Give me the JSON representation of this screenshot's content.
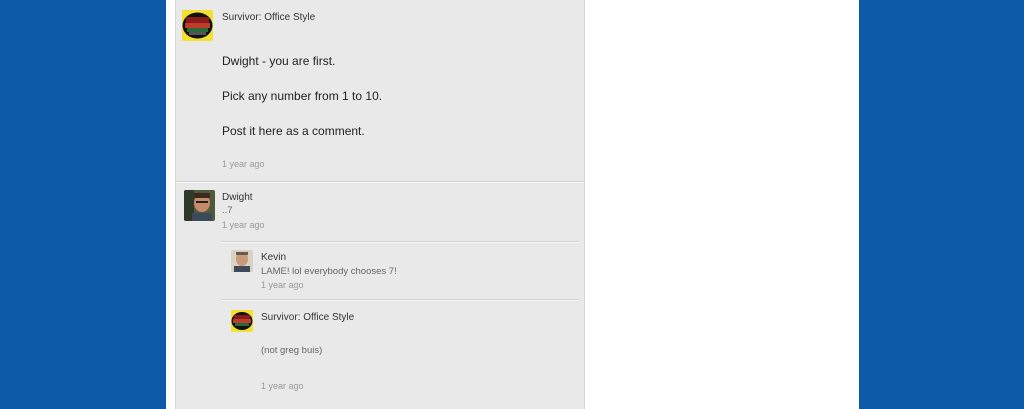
{
  "main_post": {
    "author": "Survivor: Office Style",
    "lines": [
      "Dwight  -  you are first.",
      "Pick any number from 1 to 10.",
      "Post it here as a comment."
    ],
    "time": "1 year ago"
  },
  "comment": {
    "author": "Dwight",
    "text": "..7",
    "time": "1 year ago"
  },
  "replies": [
    {
      "author": "Kevin",
      "text": "LAME!  lol everybody chooses 7!",
      "time": "1 year ago"
    },
    {
      "author": "Survivor: Office Style",
      "text": "(not greg buis)",
      "time": "1 year ago"
    }
  ],
  "colors": {
    "outer_background": "#0d5aa8",
    "feed_background": "#e9e9e9"
  }
}
